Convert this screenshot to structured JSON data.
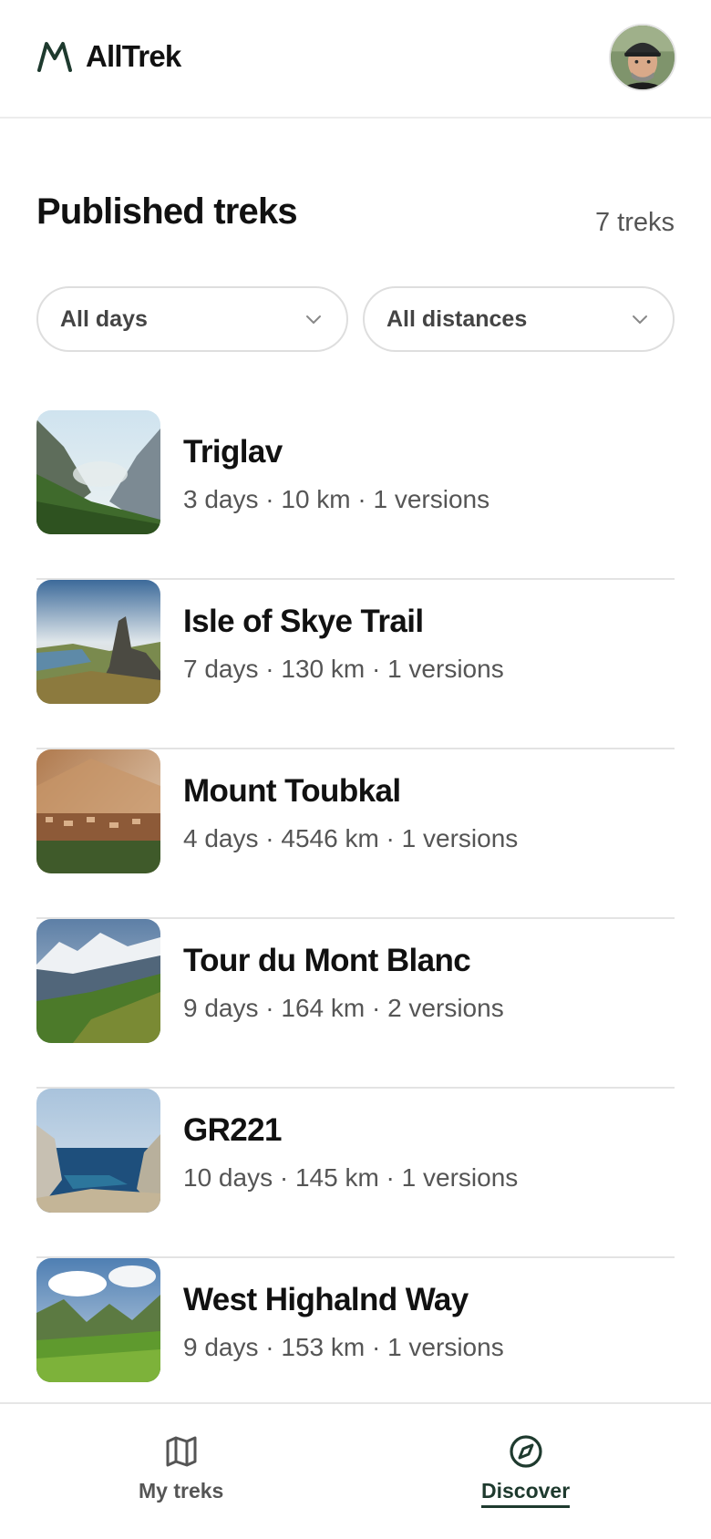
{
  "brand": {
    "name": "AllTrek"
  },
  "section": {
    "title": "Published treks",
    "count": "7 treks"
  },
  "filters": [
    {
      "label": "All days"
    },
    {
      "label": "All distances"
    }
  ],
  "treks": [
    {
      "name": "Triglav",
      "meta": "3 days · 10 km · 1 versions"
    },
    {
      "name": "Isle of Skye Trail",
      "meta": "7 days · 130 km · 1 versions"
    },
    {
      "name": "Mount Toubkal",
      "meta": "4 days · 4546 km · 1 versions"
    },
    {
      "name": "Tour du Mont Blanc",
      "meta": "9 days · 164 km · 2 versions"
    },
    {
      "name": "GR221",
      "meta": "10 days · 145 km · 1 versions"
    },
    {
      "name": "West Highalnd Way",
      "meta": "9 days · 153 km · 1 versions"
    }
  ],
  "nav": [
    {
      "label": "My treks",
      "icon": "map-icon"
    },
    {
      "label": "Discover",
      "icon": "compass-icon",
      "active": true
    }
  ],
  "colors": {
    "brand": "#1e3a2e",
    "divider": "#e3e3e3",
    "muted_text": "#555555"
  }
}
